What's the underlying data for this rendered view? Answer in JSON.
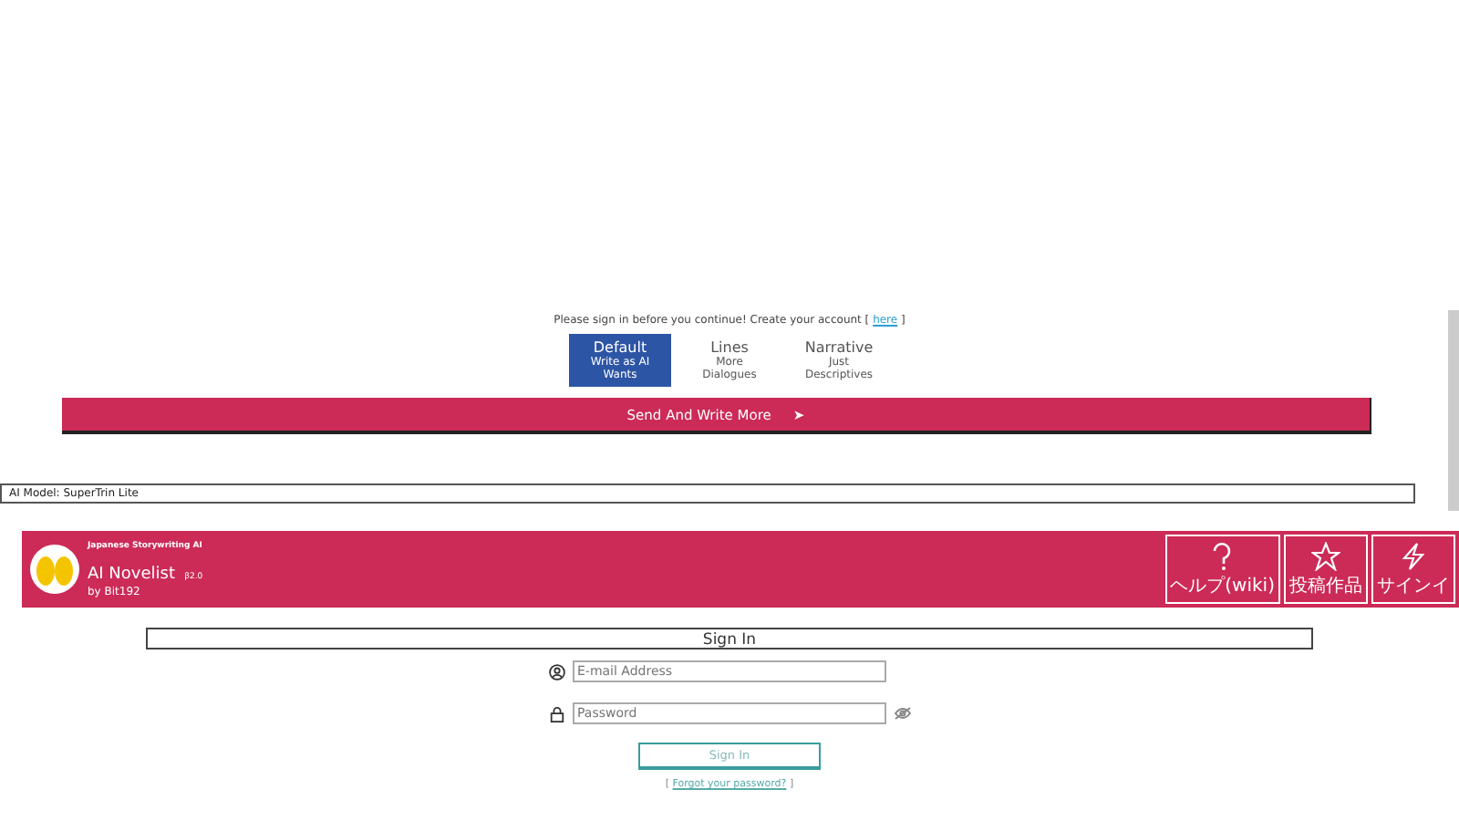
{
  "notice": {
    "text": "Please sign in before you continue! Create your account [",
    "link": "here",
    "after": "]"
  },
  "modes": [
    {
      "label": "Default",
      "sub": "Write as AI Wants",
      "selected": true
    },
    {
      "label": "Lines",
      "sub": "More Dialogues",
      "selected": false
    },
    {
      "label": "Narrative",
      "sub": "Just Descriptives",
      "selected": false
    }
  ],
  "send_button": {
    "label": "Send And Write More",
    "arrow": "➤"
  },
  "model_field": {
    "value": "AI Model: SuperTrin Lite"
  },
  "header": {
    "tagline": "Japanese Storywriting AI",
    "title": "AI Novelist",
    "version": "β2.0",
    "byline": "by Bit192",
    "buttons": [
      {
        "kind": "help",
        "label": "ヘルプ(wiki)"
      },
      {
        "kind": "star",
        "label": "投稿作品"
      },
      {
        "kind": "bolt",
        "label": "サインイ"
      }
    ]
  },
  "signin": {
    "title": "Sign In",
    "email_placeholder": "E-mail Address",
    "password_placeholder": "Password",
    "button": "Sign In",
    "forgot_open": "[",
    "forgot_link": "Forgot your password?",
    "forgot_close": "]"
  }
}
